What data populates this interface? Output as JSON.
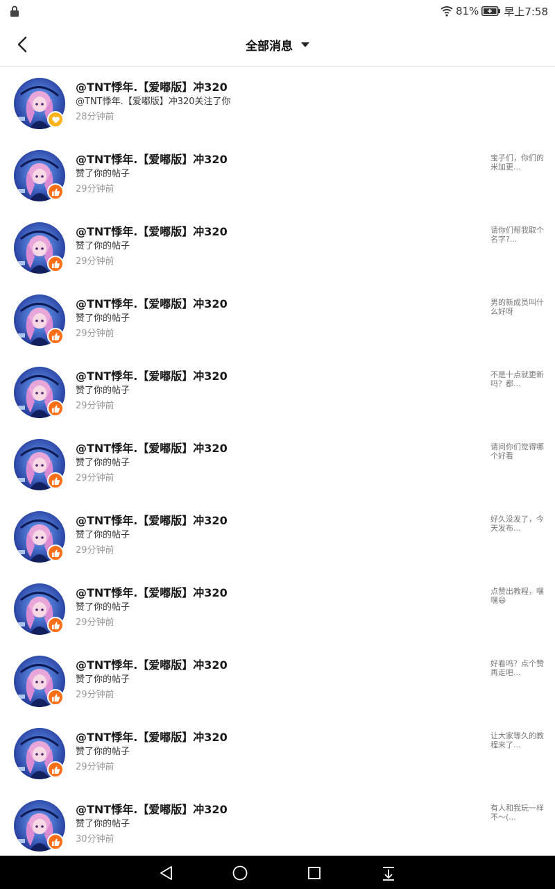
{
  "status_bar": {
    "battery_percent": "81%",
    "time": "早上7:58",
    "icons": [
      "lock-icon",
      "wifi-icon",
      "battery-charging-icon"
    ]
  },
  "header": {
    "title": "全部消息",
    "back_icon": "chevron-left-icon",
    "dropdown_icon": "caret-down-icon"
  },
  "colors": {
    "like_badge": "#ff6f1a",
    "follow_badge": "#ffb31a",
    "nav_bar": "#000000"
  },
  "messages": [
    {
      "user": "@TNT悸年.【爱嘟版】冲320",
      "action": "@TNT悸年.【爱嘟版】冲320关注了你",
      "time": "28分钟前",
      "preview": "",
      "badge": "heart-icon"
    },
    {
      "user": "@TNT悸年.【爱嘟版】冲320",
      "action": "赞了你的帖子",
      "time": "29分钟前",
      "preview": "宝子们，你们的米加更...",
      "badge": "thumbs-up-icon"
    },
    {
      "user": "@TNT悸年.【爱嘟版】冲320",
      "action": "赞了你的帖子",
      "time": "29分钟前",
      "preview": "请你们帮我取个名字?...",
      "badge": "thumbs-up-icon"
    },
    {
      "user": "@TNT悸年.【爱嘟版】冲320",
      "action": "赞了你的帖子",
      "time": "29分钟前",
      "preview": "男的新成员叫什么好呀",
      "badge": "thumbs-up-icon"
    },
    {
      "user": "@TNT悸年.【爱嘟版】冲320",
      "action": "赞了你的帖子",
      "time": "29分钟前",
      "preview": "不是十点就更新吗？都...",
      "badge": "thumbs-up-icon"
    },
    {
      "user": "@TNT悸年.【爱嘟版】冲320",
      "action": "赞了你的帖子",
      "time": "29分钟前",
      "preview": "请问你们觉得哪个好看",
      "badge": "thumbs-up-icon"
    },
    {
      "user": "@TNT悸年.【爱嘟版】冲320",
      "action": "赞了你的帖子",
      "time": "29分钟前",
      "preview": "好久没发了，今天发布...",
      "badge": "thumbs-up-icon"
    },
    {
      "user": "@TNT悸年.【爱嘟版】冲320",
      "action": "赞了你的帖子",
      "time": "29分钟前",
      "preview": "点赞出教程，嘿嘿😄",
      "badge": "thumbs-up-icon"
    },
    {
      "user": "@TNT悸年.【爱嘟版】冲320",
      "action": "赞了你的帖子",
      "time": "29分钟前",
      "preview": "好看吗？点个赞再走吧...",
      "badge": "thumbs-up-icon"
    },
    {
      "user": "@TNT悸年.【爱嘟版】冲320",
      "action": "赞了你的帖子",
      "time": "29分钟前",
      "preview": "让大家等久的教程来了...",
      "badge": "thumbs-up-icon"
    },
    {
      "user": "@TNT悸年.【爱嘟版】冲320",
      "action": "赞了你的帖子",
      "time": "30分钟前",
      "preview": "有人和我玩一样不～(...",
      "badge": "thumbs-up-icon"
    }
  ],
  "nav_bar": {
    "icons": [
      "nav-back-icon",
      "nav-home-icon",
      "nav-recents-icon",
      "nav-collapse-icon"
    ]
  }
}
